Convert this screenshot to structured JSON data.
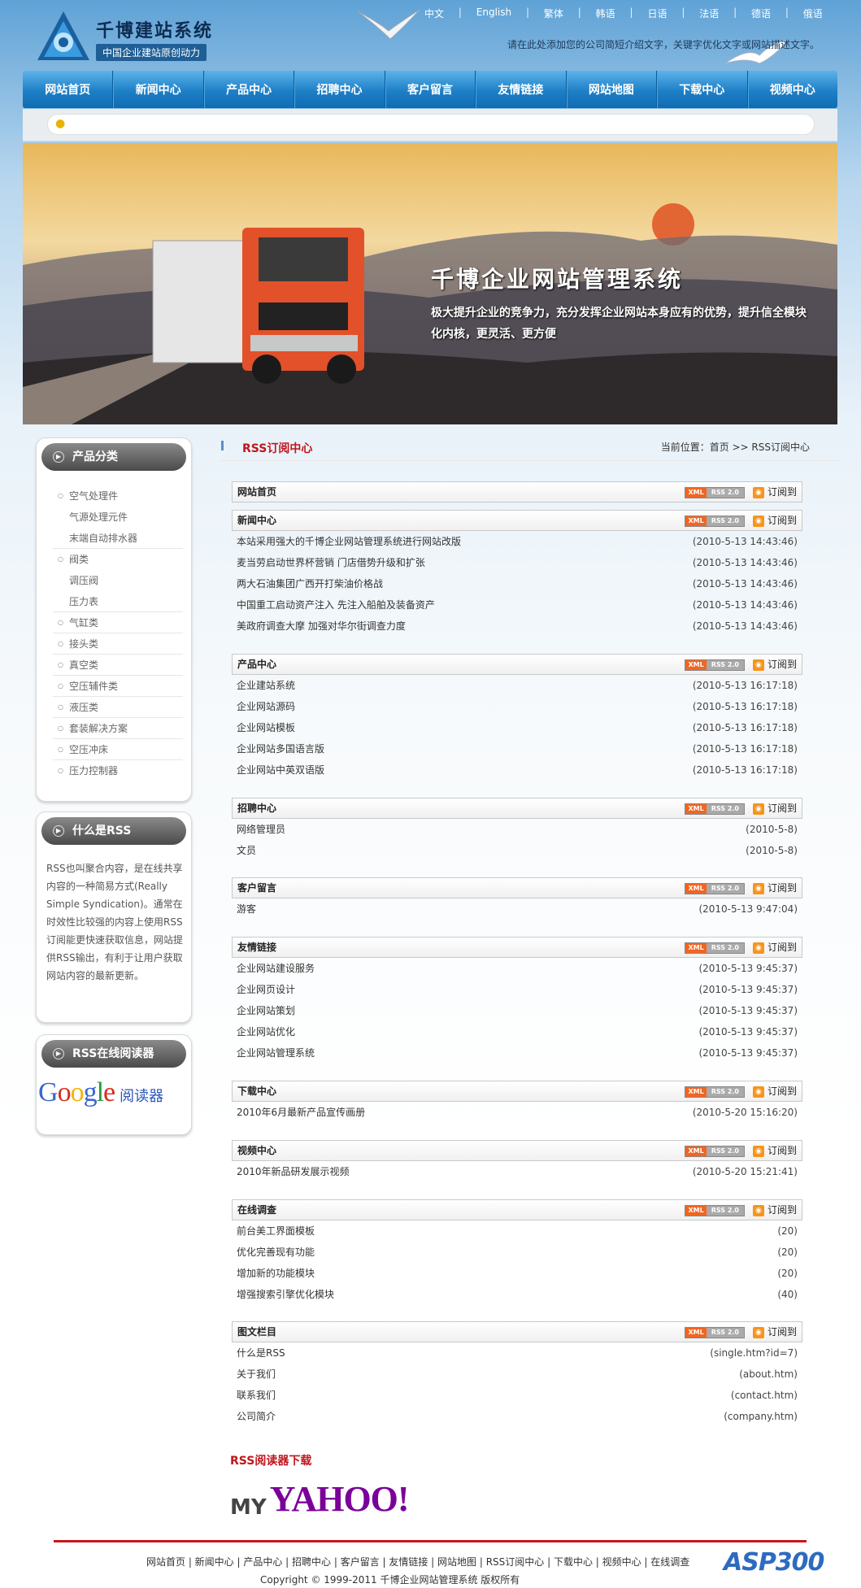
{
  "header": {
    "logo_title": "千博建站系统",
    "logo_sub": "中国企业建站原创动力",
    "languages": [
      "中文",
      "English",
      "繁体",
      "韩语",
      "日语",
      "法语",
      "德语",
      "俄语"
    ],
    "tagline": "请在此处添加您的公司简短介绍文字，关键字优化文字或网站描述文字。"
  },
  "nav": [
    "网站首页",
    "新闻中心",
    "产品中心",
    "招聘中心",
    "客户留言",
    "友情链接",
    "网站地图",
    "下载中心",
    "视频中心"
  ],
  "banner": {
    "title": "千博企业网站管理系统",
    "text": "极大提升企业的竞争力，充分发挥企业网站本身应有的优势，提升信全模块化内核，更灵活、更方便"
  },
  "sidebar": {
    "category_title": "产品分类",
    "categories": [
      {
        "label": "空气处理件",
        "level": "top"
      },
      {
        "label": "气源处理元件",
        "level": "child"
      },
      {
        "label": "末端自动排水器",
        "level": "child"
      },
      {
        "label": "阀类",
        "level": "top"
      },
      {
        "label": "调压阀",
        "level": "child"
      },
      {
        "label": "压力表",
        "level": "child"
      },
      {
        "label": "气缸类",
        "level": "top"
      },
      {
        "label": "接头类",
        "level": "top"
      },
      {
        "label": "真空类",
        "level": "top"
      },
      {
        "label": "空压辅件类",
        "level": "top"
      },
      {
        "label": "液压类",
        "level": "top"
      },
      {
        "label": "套装解决方案",
        "level": "top"
      },
      {
        "label": "空压冲床",
        "level": "top"
      },
      {
        "label": "压力控制器",
        "level": "top"
      }
    ],
    "rss_title": "什么是RSS",
    "rss_desc": "RSS也叫聚合内容，是在线共享内容的一种简易方式(Really Simple Syndication)。通常在时效性比较强的内容上使用RSS订阅能更快速获取信息，网站提供RSS输出，有利于让用户获取网站内容的最新更新。",
    "reader_title": "RSS在线阅读器",
    "google_text": "Google",
    "google_reader": "阅读器"
  },
  "main": {
    "title": "RSS订阅中心",
    "breadcrumb": "当前位置：首页 >> RSS订阅中心",
    "badge_xml": "XML",
    "badge_rss": "RSS 2.0",
    "subscribe": "订阅到",
    "sections": [
      {
        "title": "网站首页",
        "rows": []
      },
      {
        "title": "新闻中心",
        "rows": [
          [
            "本站采用强大的千博企业网站管理系统进行网站改版",
            "(2010-5-13 14:43:46)"
          ],
          [
            "麦当劳启动世界杯营销 门店借势升级和扩张",
            "(2010-5-13 14:43:46)"
          ],
          [
            "两大石油集团广西开打柴油价格战",
            "(2010-5-13 14:43:46)"
          ],
          [
            "中国重工启动资产注入 先注入船舶及装备资产",
            "(2010-5-13 14:43:46)"
          ],
          [
            "美政府调查大摩 加强对华尔街调查力度",
            "(2010-5-13 14:43:46)"
          ]
        ]
      },
      {
        "title": "产品中心",
        "rows": [
          [
            "企业建站系统",
            "(2010-5-13 16:17:18)"
          ],
          [
            "企业网站源码",
            "(2010-5-13 16:17:18)"
          ],
          [
            "企业网站模板",
            "(2010-5-13 16:17:18)"
          ],
          [
            "企业网站多国语言版",
            "(2010-5-13 16:17:18)"
          ],
          [
            "企业网站中英双语版",
            "(2010-5-13 16:17:18)"
          ]
        ]
      },
      {
        "title": "招聘中心",
        "rows": [
          [
            "网络管理员",
            "(2010-5-8)"
          ],
          [
            "文员",
            "(2010-5-8)"
          ]
        ]
      },
      {
        "title": "客户留言",
        "rows": [
          [
            "游客",
            "(2010-5-13 9:47:04)"
          ]
        ]
      },
      {
        "title": "友情链接",
        "rows": [
          [
            "企业网站建设服务",
            "(2010-5-13 9:45:37)"
          ],
          [
            "企业网页设计",
            "(2010-5-13 9:45:37)"
          ],
          [
            "企业网站策划",
            "(2010-5-13 9:45:37)"
          ],
          [
            "企业网站优化",
            "(2010-5-13 9:45:37)"
          ],
          [
            "企业网站管理系统",
            "(2010-5-13 9:45:37)"
          ]
        ]
      },
      {
        "title": "下载中心",
        "rows": [
          [
            "2010年6月最新产品宣传画册",
            "(2010-5-20 15:16:20)"
          ]
        ]
      },
      {
        "title": "视频中心",
        "rows": [
          [
            "2010年新品研发展示视频",
            "(2010-5-20 15:21:41)"
          ]
        ]
      },
      {
        "title": "在线调查",
        "rows": [
          [
            "前台美工界面模板",
            "(20)"
          ],
          [
            "优化完善现有功能",
            "(20)"
          ],
          [
            "增加新的功能模块",
            "(20)"
          ],
          [
            "增强搜索引擎优化模块",
            "(40)"
          ]
        ]
      },
      {
        "title": "图文栏目",
        "rows": [
          [
            "什么是RSS",
            "(single.htm?id=7)"
          ],
          [
            "关于我们",
            "(about.htm)"
          ],
          [
            "联系我们",
            "(contact.htm)"
          ],
          [
            "公司简介",
            "(company.htm)"
          ]
        ]
      }
    ],
    "download_title": "RSS阅读器下载",
    "yahoo_my": "MY",
    "yahoo_text": "YAHOO!"
  },
  "footer": {
    "links": "网站首页 | 新闻中心 | 产品中心 | 招聘中心 | 客户留言 | 友情链接 | 网站地图 | RSS订阅中心 | 下载中心 | 视频中心 | 在线调查",
    "copyright": "Copyright © 1999-2011 千博企业网站管理系统 版权所有",
    "watermark": "ASP300"
  },
  "colors": {
    "accent_red": "#c0161d",
    "nav_blue": "#1d7fc6",
    "rss_orange": "#f7941d"
  }
}
